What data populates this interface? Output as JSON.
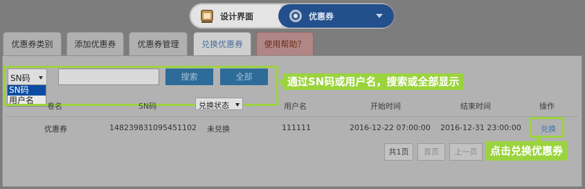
{
  "switcher": {
    "left_label": "设计界面",
    "right_label": "优惠券"
  },
  "tabs": [
    {
      "label": "优惠券类别"
    },
    {
      "label": "添加优惠券"
    },
    {
      "label": "优惠券管理"
    },
    {
      "label": "兑换优惠券"
    },
    {
      "label": "使用帮助？"
    }
  ],
  "search": {
    "select_value": "SN码",
    "options": [
      "SN码",
      "用户名"
    ],
    "input_value": "",
    "search_button": "搜索",
    "all_button": "全部"
  },
  "callouts": {
    "search_hint": "通过SN码或用户名，搜索或全部显示",
    "redeem_hint": "点击兑换优惠券"
  },
  "table": {
    "headers": [
      "卷名",
      "SN码",
      "兑换状态",
      "用户名",
      "开始时间",
      "结束时间",
      "操作"
    ],
    "rows": [
      [
        "优惠券",
        "148239831095451102",
        "未兑换",
        "111111",
        "2016-12-22 07:00:00",
        "2016-12-31 23:00:00",
        "兑换"
      ]
    ]
  },
  "pagination": {
    "total": "共1页",
    "first": "首页",
    "prev": "上一页"
  },
  "colors": {
    "accent_green": "#9bd33e",
    "brand_blue": "#234f8c",
    "link_blue": "#3a74b3"
  }
}
